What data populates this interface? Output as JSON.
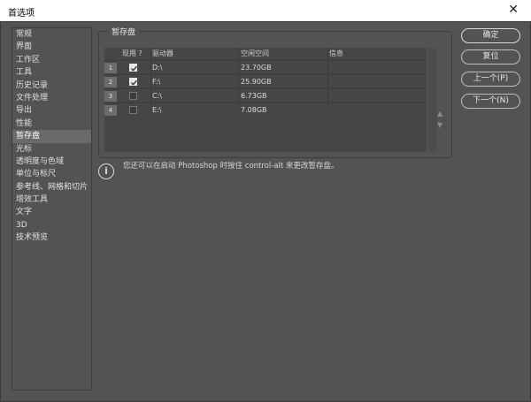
{
  "window": {
    "title": "首选项",
    "close_glyph": "✕"
  },
  "sidebar": {
    "items": [
      {
        "label": "常规"
      },
      {
        "label": "界面"
      },
      {
        "label": "工作区"
      },
      {
        "label": "工具"
      },
      {
        "label": "历史记录"
      },
      {
        "label": "文件处理"
      },
      {
        "label": "导出"
      },
      {
        "label": "性能"
      },
      {
        "label": "暂存盘",
        "active": true
      },
      {
        "label": "光标"
      },
      {
        "label": "透明度与色域"
      },
      {
        "label": "单位与标尺"
      },
      {
        "label": "参考线、网格和切片"
      },
      {
        "label": "增效工具"
      },
      {
        "label": "文字"
      },
      {
        "label": "3D"
      },
      {
        "label": "技术预览"
      }
    ]
  },
  "scratch": {
    "group_title": "暂存盘",
    "columns": {
      "active": "现用 ?",
      "drive": "驱动器",
      "space": "空闲空间",
      "info": "信息"
    },
    "rows": [
      {
        "num": "1",
        "checked": true,
        "drive": "D:\\",
        "space": "23.70GB",
        "info": ""
      },
      {
        "num": "2",
        "checked": true,
        "drive": "F:\\",
        "space": "25.90GB",
        "info": ""
      },
      {
        "num": "3",
        "checked": false,
        "drive": "C:\\",
        "space": "6.73GB",
        "info": ""
      },
      {
        "num": "4",
        "checked": false,
        "drive": "E:\\",
        "space": "7.08GB",
        "info": ""
      }
    ],
    "move_up": "▲",
    "move_down": "▼"
  },
  "note": {
    "icon": "i",
    "text": "您还可以在启动 Photoshop 时按住 control-alt 来更改暂存盘。"
  },
  "buttons": {
    "ok": "确定",
    "reset": "复位",
    "prev": "上一个(P)",
    "next": "下一个(N)"
  },
  "colors": {
    "background": "#535353",
    "active_item": "#6a6a6a"
  }
}
